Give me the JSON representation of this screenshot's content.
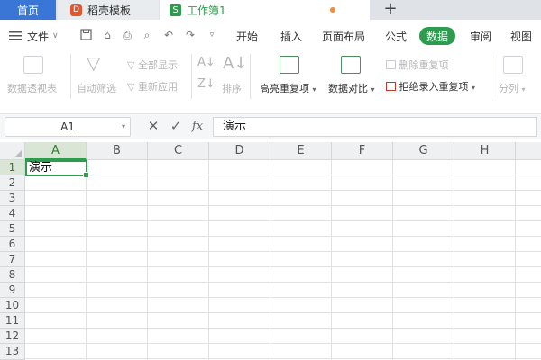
{
  "tabs": {
    "home": "首页",
    "template": "稻壳模板",
    "workbook": "工作簿1",
    "template_icon": "D",
    "workbook_icon": "S",
    "add_glyph": "+"
  },
  "menu": {
    "file": "文件",
    "items": [
      "开始",
      "插入",
      "页面布局",
      "公式",
      "数据",
      "审阅",
      "视图"
    ],
    "active": "数据"
  },
  "ribbon": {
    "pivot": "数据透视表",
    "autofilter": "自动筛选",
    "show_all": "全部显示",
    "reapply": "重新应用",
    "sort": "排序",
    "highlight_dup": "高亮重复项",
    "compare": "数据对比",
    "delete_dup": "删除重复项",
    "reject_dup": "拒绝录入重复项",
    "split": "分列"
  },
  "formula_bar": {
    "cell_ref": "A1",
    "fx": "fx",
    "cancel": "✕",
    "confirm": "✓",
    "content": "演示"
  },
  "grid": {
    "columns": [
      "A",
      "B",
      "C",
      "D",
      "E",
      "F",
      "G",
      "H"
    ],
    "rows": [
      "1",
      "2",
      "3",
      "4",
      "5",
      "6",
      "7",
      "8",
      "9",
      "10",
      "11",
      "12",
      "13"
    ],
    "selected_column": "A",
    "selected_row": "1",
    "a1_value": "演示"
  },
  "colors": {
    "accent": "#2e9b4e",
    "home_tab": "#3a76d6",
    "template_brand": "#e8542a"
  }
}
